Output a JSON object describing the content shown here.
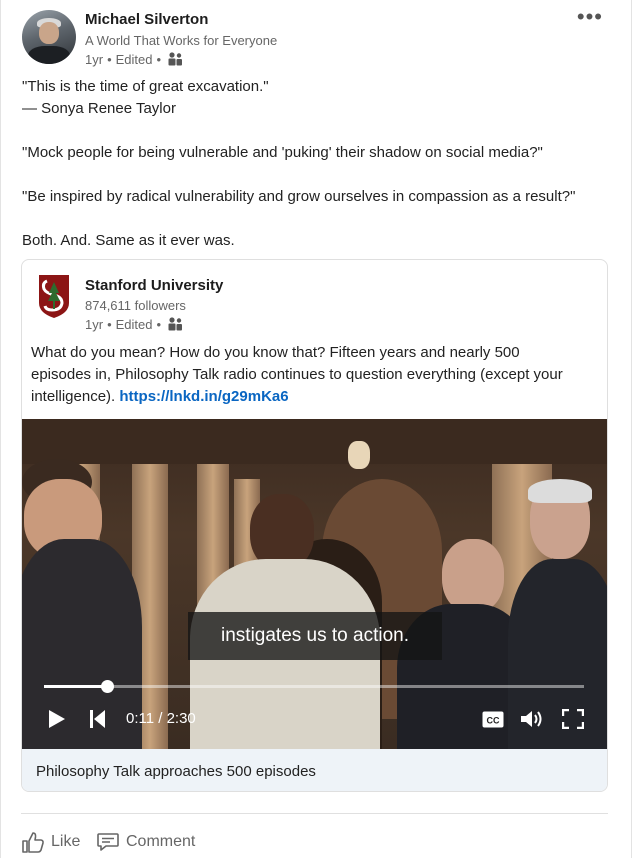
{
  "post": {
    "author": {
      "name": "Michael Silverton",
      "headline": "A World That Works for Everyone"
    },
    "meta": {
      "age": "1yr",
      "edited": "Edited",
      "sep": "•",
      "visibility_icon": "people-icon"
    },
    "more_label": "•••",
    "text_lines": [
      "\"This is the time of great excavation.\"",
      "— Sonya Renee Taylor",
      "\"Mock people for being vulnerable and 'puking' their shadow on social media?\"",
      "\"Be inspired by radical vulnerability and grow ourselves in compassion as a result?\"",
      "Both. And. Same as it ever was."
    ]
  },
  "reshare": {
    "org": {
      "name": "Stanford University",
      "followers": "874,611 followers",
      "logo_color": "#8c1515"
    },
    "meta": {
      "age": "1yr",
      "edited": "Edited",
      "sep": "•"
    },
    "body": {
      "line1": "What do you mean? How do you know that? Fifteen years and nearly 500",
      "line2": "episodes in, Philosophy Talk radio continues to question everything (except your",
      "line3": "intelligence).",
      "link": "https://lnkd.in/g29mKa6"
    },
    "video": {
      "caption": "instigates us to action.",
      "time": "0:11 / 2:30",
      "progress": 0.117,
      "title": "Philosophy Talk approaches 500 episodes"
    }
  },
  "actions": {
    "like": "Like",
    "comment": "Comment"
  },
  "colors": {
    "link": "#0a66c2",
    "title_bar_bg": "#eef3f8"
  }
}
